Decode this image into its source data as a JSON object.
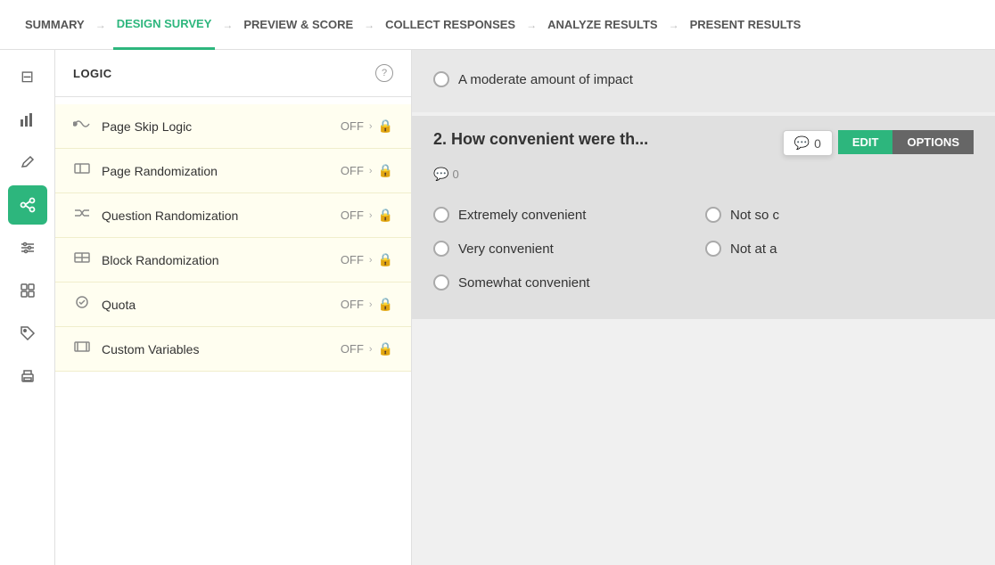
{
  "nav": {
    "items": [
      {
        "label": "SUMMARY",
        "active": false
      },
      {
        "label": "DESIGN SURVEY",
        "active": true
      },
      {
        "label": "PREVIEW & SCORE",
        "active": false
      },
      {
        "label": "COLLECT RESPONSES",
        "active": false
      },
      {
        "label": "ANALYZE RESULTS",
        "active": false
      },
      {
        "label": "PRESENT RESULTS",
        "active": false
      }
    ]
  },
  "sidebar_icons": [
    {
      "name": "inbox-icon",
      "symbol": "⊟",
      "active": false
    },
    {
      "name": "chart-icon",
      "symbol": "▦",
      "active": false
    },
    {
      "name": "edit-icon",
      "symbol": "✏",
      "active": false
    },
    {
      "name": "logic-icon",
      "symbol": "⧓",
      "active": true
    },
    {
      "name": "sliders-icon",
      "symbol": "⊞",
      "active": false
    },
    {
      "name": "grid-icon",
      "symbol": "⊞",
      "active": false
    },
    {
      "name": "tag-icon",
      "symbol": "🏷",
      "active": false
    },
    {
      "name": "print-icon",
      "symbol": "⎙",
      "active": false
    }
  ],
  "logic": {
    "title": "LOGIC",
    "help": "?",
    "items": [
      {
        "icon": "📻",
        "label": "Page Skip Logic",
        "status": "OFF",
        "locked": true
      },
      {
        "icon": "⊠",
        "label": "Page Randomization",
        "status": "OFF",
        "locked": true
      },
      {
        "icon": "⇄",
        "label": "Question Randomization",
        "status": "OFF",
        "locked": true
      },
      {
        "icon": "⊠",
        "label": "Block Randomization",
        "status": "OFF",
        "locked": true
      },
      {
        "icon": "✓",
        "label": "Quota",
        "status": "OFF",
        "locked": true
      },
      {
        "icon": "[ ]",
        "label": "Custom Variables",
        "status": "OFF",
        "locked": true
      }
    ]
  },
  "content": {
    "partial_option": {
      "text": "A moderate amount of impact"
    },
    "question2": {
      "number": "2.",
      "title": "How convenient were th",
      "title_full": "How convenient were th...",
      "comment_count": "0",
      "comment_count_below": "0",
      "edit_label": "EDIT",
      "options_label": "OPTIONS",
      "options": [
        {
          "text": "Extremely convenient",
          "col": 1
        },
        {
          "text": "Not so c",
          "col": 2
        },
        {
          "text": "Very convenient",
          "col": 1
        },
        {
          "text": "Not at a",
          "col": 2
        },
        {
          "text": "Somewhat convenient",
          "col": 1
        }
      ]
    }
  }
}
